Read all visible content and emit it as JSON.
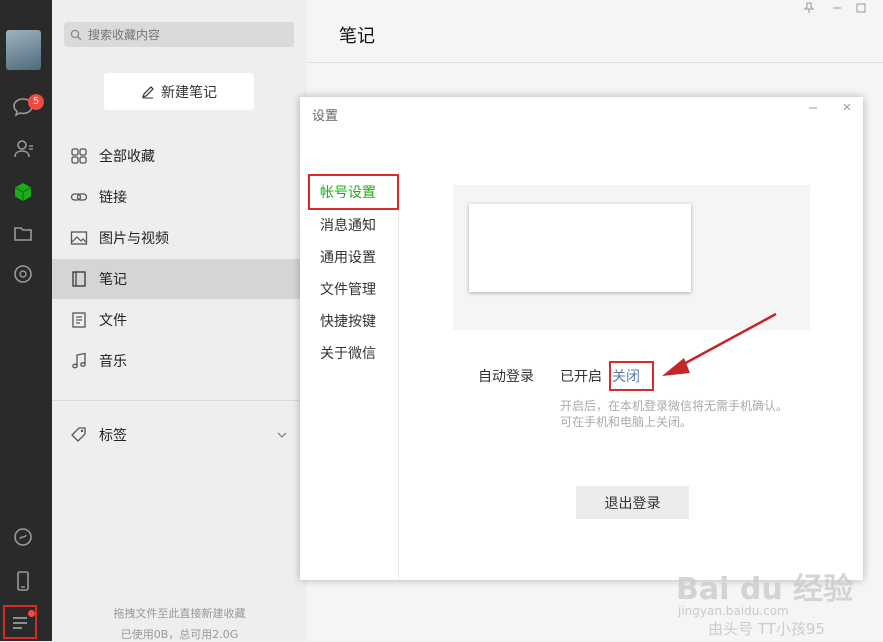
{
  "rail": {
    "chat_badge": "5"
  },
  "panel": {
    "search_placeholder": "搜索收藏内容",
    "new_note_label": "新建笔记",
    "nav": [
      {
        "label": "全部收藏",
        "icon": "grid-icon"
      },
      {
        "label": "链接",
        "icon": "link-icon"
      },
      {
        "label": "图片与视频",
        "icon": "image-icon"
      },
      {
        "label": "笔记",
        "icon": "note-icon",
        "active": true
      },
      {
        "label": "文件",
        "icon": "file-icon"
      },
      {
        "label": "音乐",
        "icon": "music-icon"
      }
    ],
    "tags_label": "标签",
    "footer_line1": "拖拽文件至此直接新建收藏",
    "footer_line2": "已使用0B，总可用2.0G"
  },
  "main": {
    "title": "笔记"
  },
  "dialog": {
    "title": "设置",
    "nav": [
      "帐号设置",
      "消息通知",
      "通用设置",
      "文件管理",
      "快捷按键",
      "关于微信"
    ],
    "auto_login_label": "自动登录",
    "auto_login_on": "已开启",
    "auto_login_off": "关闭",
    "hint_line1": "开启后，在本机登录微信将无需手机确认。",
    "hint_line2": "可在手机和电脑上关闭。",
    "logout_label": "退出登录"
  },
  "watermark": {
    "logo": "Bai  du 经验",
    "url": "jingyan.baidu.com",
    "extra": "由头号 TT小孩95"
  },
  "colors": {
    "accent_green": "#1aad19",
    "highlight_red": "#d9292b",
    "link_blue": "#5b7ca6",
    "rail_bg": "#2a2a2a"
  }
}
